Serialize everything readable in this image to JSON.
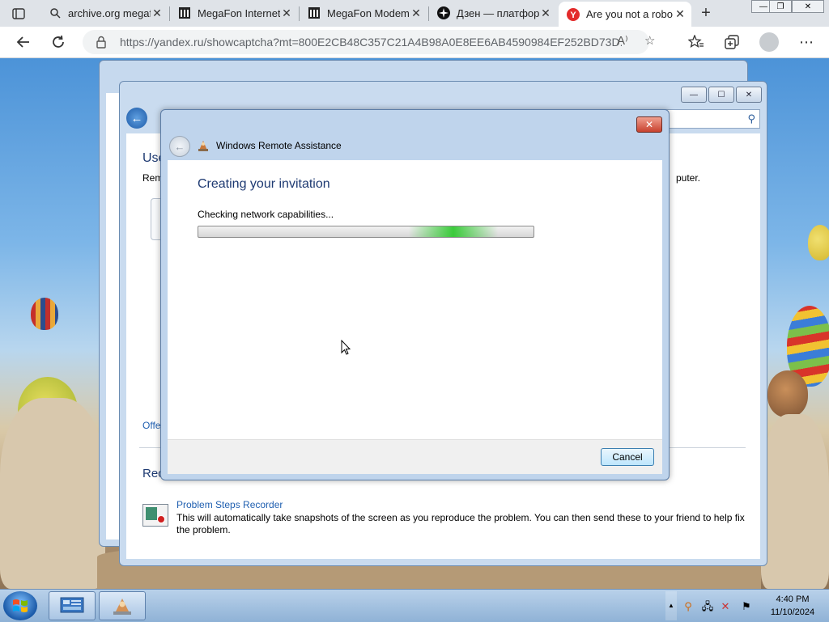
{
  "browser": {
    "tabs": [
      {
        "label": "archive.org megafo",
        "icon": "search-icon",
        "active": false
      },
      {
        "label": "MegaFon Internet",
        "icon": "archive-icon",
        "active": false
      },
      {
        "label": "MegaFon Modem",
        "icon": "archive-icon",
        "active": false
      },
      {
        "label": "Дзен — платформ",
        "icon": "dzen-icon",
        "active": false
      },
      {
        "label": "Are you not a robo",
        "icon": "yandex-icon",
        "active": true
      }
    ],
    "url": "https://yandex.ru/showcaptcha?mt=800E2CB48C357C21A4B98A0E8EE6AB4590984EF252BD73D...",
    "new_tab": "+"
  },
  "help_window": {
    "heading_partial": "Use",
    "subtext_left": "Rem",
    "subtext_right": "puter.",
    "link_partial": "Offe",
    "section_partial": "Rec",
    "psr": {
      "title": "Problem Steps Recorder",
      "description": "This will automatically take snapshots of the screen as you reproduce the problem. You can then send these to your friend to help fix the problem."
    }
  },
  "dialog": {
    "title": "Windows Remote Assistance",
    "heading": "Creating your invitation",
    "status": "Checking network capabilities...",
    "progress_style": "marquee",
    "cancel_label": "Cancel"
  },
  "taskbar": {
    "time": "4:40 PM",
    "date": "11/10/2024"
  },
  "colors": {
    "accent_blue": "#1e3a72",
    "link_blue": "#1f5fb0",
    "progress_green": "#28c828"
  }
}
